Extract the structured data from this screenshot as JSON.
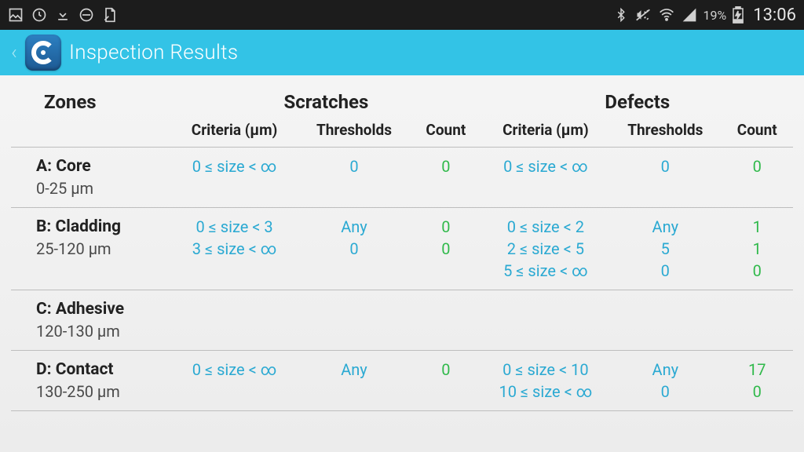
{
  "statusbar": {
    "battery_pct": "19%",
    "clock": "13:06"
  },
  "header": {
    "title": "Inspection Results"
  },
  "columns": {
    "zones": "Zones",
    "scratches": "Scratches",
    "defects": "Defects",
    "criteria": "Criteria (µm)",
    "thresholds": "Thresholds",
    "count": "Count"
  },
  "zones": [
    {
      "name": "A: Core",
      "range": "0-25 µm",
      "scratches": [
        {
          "criteria": "0 ≤ size < ∞",
          "threshold": "0",
          "count": "0"
        }
      ],
      "defects": [
        {
          "criteria": "0 ≤ size < ∞",
          "threshold": "0",
          "count": "0"
        }
      ]
    },
    {
      "name": "B: Cladding",
      "range": "25-120 µm",
      "scratches": [
        {
          "criteria": "0 ≤ size < 3",
          "threshold": "Any",
          "count": "0"
        },
        {
          "criteria": "3 ≤ size < ∞",
          "threshold": "0",
          "count": "0"
        }
      ],
      "defects": [
        {
          "criteria": "0 ≤ size < 2",
          "threshold": "Any",
          "count": "1"
        },
        {
          "criteria": "2 ≤ size < 5",
          "threshold": "5",
          "count": "1"
        },
        {
          "criteria": "5 ≤ size < ∞",
          "threshold": "0",
          "count": "0"
        }
      ]
    },
    {
      "name": "C: Adhesive",
      "range": "120-130 µm",
      "scratches": [],
      "defects": []
    },
    {
      "name": "D: Contact",
      "range": "130-250 µm",
      "scratches": [
        {
          "criteria": "0 ≤ size < ∞",
          "threshold": "Any",
          "count": "0"
        }
      ],
      "defects": [
        {
          "criteria": "0 ≤ size < 10",
          "threshold": "Any",
          "count": "17"
        },
        {
          "criteria": "10 ≤ size < ∞",
          "threshold": "0",
          "count": "0"
        }
      ]
    }
  ]
}
